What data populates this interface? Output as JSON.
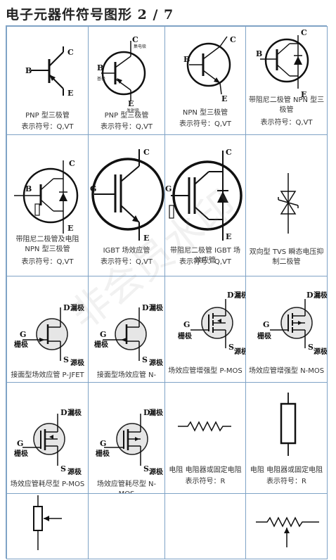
{
  "header": {
    "title": "电子元器件符号图形 2 / 7"
  },
  "watermark": "非会员水印",
  "symbols": {
    "pnp1": {
      "caption": "PNP 型三极管",
      "sub": "表示符号：Q,VT",
      "pin_b": "B",
      "pin_c": "C",
      "pin_e": "E"
    },
    "pnp2": {
      "caption": "PNP 型三极管",
      "sub": "表示符号：Q,VT",
      "pin_b": "B",
      "pin_c": "C",
      "pin_e": "E",
      "lbl_c": "集电极",
      "lbl_b": "基极",
      "lbl_e": "发射极"
    },
    "npn": {
      "caption": "NPN 型三极管",
      "sub": "表示符号：Q,VT",
      "pin_b": "B",
      "pin_c": "C",
      "pin_e": "E"
    },
    "npnd": {
      "caption": "带阻尼二极管 NPN 型三极管",
      "sub": "表示符号：Q,VT",
      "pin_b": "B",
      "pin_c": "C",
      "pin_e": "E"
    },
    "npndr": {
      "caption": "带阻尼二极管及电阻 NPN 型三极管",
      "sub": "表示符号：Q,VT",
      "pin_b": "B",
      "pin_c": "C",
      "pin_e": "E"
    },
    "igbt": {
      "caption": "IGBT 场效应管",
      "sub": "表示符号：Q,VT",
      "pin_g": "G",
      "pin_c": "C",
      "pin_e": "E"
    },
    "igbtd": {
      "caption": "带阻尼二极管 IGBT 场效应管",
      "sub": "表示符号：Q,VT",
      "pin_g": "G",
      "pin_c": "C",
      "pin_e": "E"
    },
    "tvs": {
      "caption": "双向型 TVS 瞬态电压抑制二极管"
    },
    "pjfet": {
      "caption": "接面型场效应管 P-JFET",
      "d": "D",
      "g": "G",
      "s": "S",
      "dl": "漏极",
      "gl": "栅极",
      "sl": "源极"
    },
    "njfet": {
      "caption": "接面型场效应管 N-JFET",
      "d": "D",
      "g": "G",
      "s": "S",
      "dl": "漏极",
      "gl": "栅极",
      "sl": "源极"
    },
    "pmos": {
      "caption": "场效应管增强型 P-MOS",
      "d": "D",
      "g": "G",
      "s": "S",
      "dl": "漏极",
      "gl": "栅极",
      "sl": "源极"
    },
    "nmos": {
      "caption": "场效应管增强型 N-MOS",
      "d": "D",
      "g": "G",
      "s": "S",
      "dl": "漏极",
      "gl": "栅极",
      "sl": "源极"
    },
    "pdep": {
      "caption": "场效应管耗尽型 P-MOS",
      "d": "D",
      "g": "G",
      "s": "S",
      "dl": "漏极",
      "gl": "栅极",
      "sl": "源极"
    },
    "ndep": {
      "caption": "场效应管耗尽型 N-MOS",
      "d": "D",
      "g": "G",
      "s": "S",
      "dl": "漏极",
      "gl": "栅极",
      "sl": "源极"
    },
    "res1": {
      "caption": "电阻 电阻器或固定电阻",
      "sub": "表示符号：R"
    },
    "res2": {
      "caption": "电阻 电阻器或固定电阻",
      "sub": "表示符号：R"
    }
  }
}
